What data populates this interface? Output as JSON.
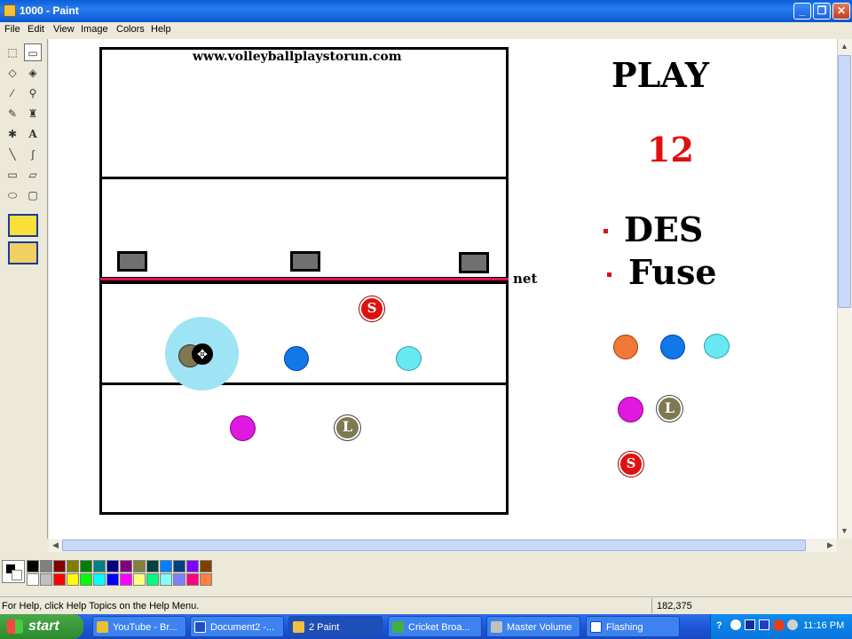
{
  "window": {
    "title": "1000 - Paint"
  },
  "menu": [
    "File",
    "Edit",
    "View",
    "Image",
    "Colors",
    "Help"
  ],
  "drawing": {
    "website": "www.volleyballplaystorun.com",
    "net_label": "net",
    "play_title": "PLAY",
    "play_number": "12",
    "bullets": [
      "DES",
      "Fuse"
    ],
    "marker_s": "S",
    "marker_l": "L",
    "colors": {
      "net": "#e0105a",
      "setter": "#e01010",
      "libero": "#807850",
      "orange": "#f07838",
      "blue": "#1078e8",
      "cyan": "#68e8f0",
      "magenta": "#e018e0",
      "highlight": "#9ee4f4",
      "play_number": "#e01010"
    }
  },
  "palette": {
    "row1": [
      "#000000",
      "#808080",
      "#800000",
      "#808000",
      "#008000",
      "#008080",
      "#000080",
      "#800080",
      "#808040",
      "#004040",
      "#0080ff",
      "#004080",
      "#8000ff",
      "#804000"
    ],
    "row2": [
      "#ffffff",
      "#c0c0c0",
      "#ff0000",
      "#ffff00",
      "#00ff00",
      "#00ffff",
      "#0000ff",
      "#ff00ff",
      "#ffff80",
      "#00ff80",
      "#80ffff",
      "#8080ff",
      "#ff0080",
      "#ff8040"
    ]
  },
  "status": {
    "help": "For Help, click Help Topics on the Help Menu.",
    "coords": "182,375"
  },
  "taskbar": {
    "start": "start",
    "tasks": [
      "YouTube - Br...",
      "Document2 -...",
      "2 Paint",
      "Cricket Broa...",
      "Master Volume",
      "Flashing"
    ],
    "time": "11:16 PM"
  }
}
